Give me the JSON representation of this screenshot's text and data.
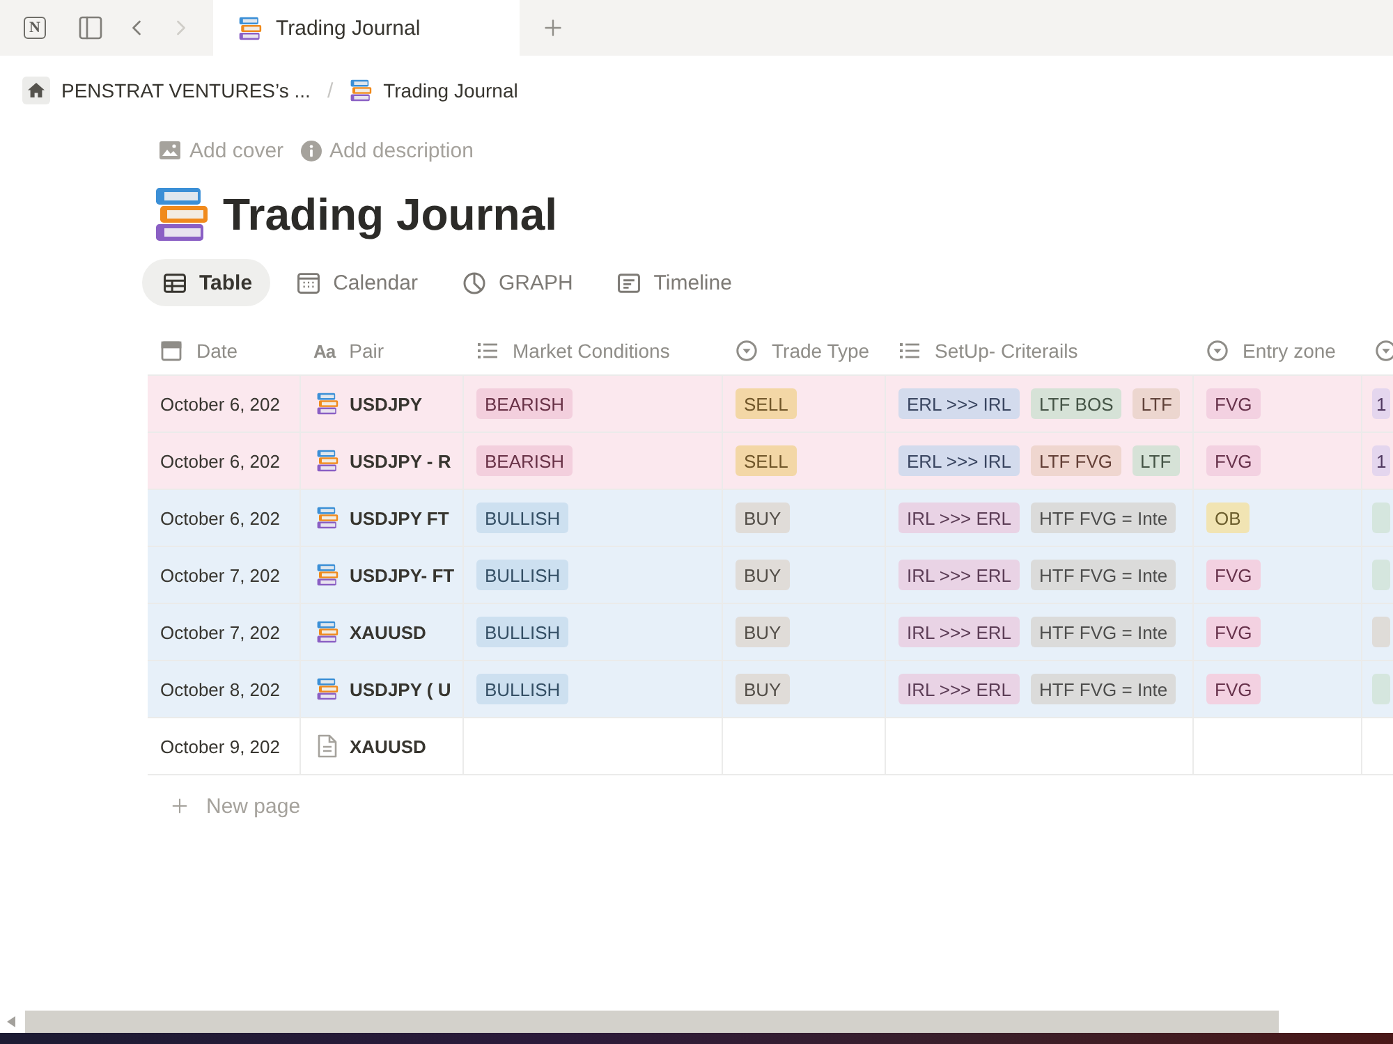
{
  "app": {
    "logo": "N"
  },
  "nav_buttons": [
    {
      "kind": "sidebar",
      "disabled": false
    },
    {
      "kind": "back",
      "disabled": false
    },
    {
      "kind": "forward",
      "disabled": true
    }
  ],
  "browser_tabs": [
    {
      "title": "Trading Journal",
      "selected": true
    }
  ],
  "breadcrumb": {
    "separator": "/",
    "items": [
      {
        "kind": "workspace",
        "label": "PENSTRAT VENTURES’s ..."
      },
      {
        "kind": "page",
        "label": "Trading Journal"
      }
    ]
  },
  "page_actions": [
    {
      "kind": "cover",
      "label": "Add cover"
    },
    {
      "kind": "description",
      "label": "Add description"
    }
  ],
  "title": "Trading Journal",
  "views": [
    {
      "kind": "table",
      "label": "Table",
      "selected": true
    },
    {
      "kind": "calendar",
      "label": "Calendar",
      "selected": false
    },
    {
      "kind": "chart",
      "label": "GRAPH",
      "selected": false
    },
    {
      "kind": "timeline",
      "label": "Timeline",
      "selected": false
    }
  ],
  "table": {
    "columns": [
      {
        "kind": "date",
        "label": "Date"
      },
      {
        "kind": "title",
        "glyph": "Aa",
        "label": "Pair"
      },
      {
        "kind": "multi",
        "label": "Market Conditions"
      },
      {
        "kind": "select",
        "label": "Trade Type"
      },
      {
        "kind": "multi",
        "label": "SetUp- Criterails"
      },
      {
        "kind": "select",
        "label": "Entry zone"
      },
      {
        "kind": "select"
      }
    ],
    "rows": [
      {
        "color": "#fbe8ee",
        "cells": [
          "October 6, 202",
          {
            "text": "USDJPY",
            "kind": "emoji"
          },
          [
            {
              "text": "BEARISH",
              "color": "#f3cfdd"
            }
          ],
          {
            "text": "SELL",
            "color": "#f3d7a6"
          },
          [
            {
              "text": "ERL >>> IRL",
              "color": "#d3dbed"
            },
            {
              "text": "LTF BOS",
              "color": "#d6e2d7"
            },
            {
              "text": "LTF",
              "color": "#ecd6cf"
            }
          ],
          {
            "text": "FVG",
            "color": "#f3d1e1"
          },
          {
            "text": "1",
            "color": "#e4d6ee"
          }
        ]
      },
      {
        "color": "#fbe8ee",
        "cells": [
          "October 6, 202",
          {
            "text": "USDJPY - R",
            "kind": "emoji"
          },
          [
            {
              "text": "BEARISH",
              "color": "#f3cfdd"
            }
          ],
          {
            "text": "SELL",
            "color": "#f3d7a6"
          },
          [
            {
              "text": "ERL >>> IRL",
              "color": "#d3dbed"
            },
            {
              "text": "LTF FVG",
              "color": "#efd6cf"
            },
            {
              "text": "LTF",
              "color": "#d6e2d7"
            }
          ],
          {
            "text": "FVG",
            "color": "#f3d1e1"
          },
          {
            "text": "1",
            "color": "#e4d6ee"
          }
        ]
      },
      {
        "color": "#e7f0f9",
        "cells": [
          "October 6, 202",
          {
            "text": "USDJPY FT",
            "kind": "emoji"
          },
          [
            {
              "text": "BULLISH",
              "color": "#cde0f0"
            }
          ],
          {
            "text": "BUY",
            "color": "#e0dcd8"
          },
          [
            {
              "text": "IRL >>> ERL",
              "color": "#e9d3e5"
            },
            {
              "text": "HTF FVG = Inte",
              "color": "#dbdbda"
            }
          ],
          {
            "text": "OB",
            "color": "#f1e4b3"
          },
          {
            "color": "#d5e6de"
          }
        ]
      },
      {
        "color": "#e7f0f9",
        "cells": [
          "October 7, 202",
          {
            "text": "USDJPY- FT",
            "kind": "emoji"
          },
          [
            {
              "text": "BULLISH",
              "color": "#cde0f0"
            }
          ],
          {
            "text": "BUY",
            "color": "#e0dcd8"
          },
          [
            {
              "text": "IRL >>> ERL",
              "color": "#e9d3e5"
            },
            {
              "text": "HTF FVG = Inte",
              "color": "#dbdbda"
            }
          ],
          {
            "text": "FVG",
            "color": "#f3d1e1"
          },
          {
            "color": "#d5e6de"
          }
        ]
      },
      {
        "color": "#e7f0f9",
        "cells": [
          "October 7, 202",
          {
            "text": "XAUUSD",
            "kind": "emoji"
          },
          [
            {
              "text": "BULLISH",
              "color": "#cde0f0"
            }
          ],
          {
            "text": "BUY",
            "color": "#e0dcd8"
          },
          [
            {
              "text": "IRL >>> ERL",
              "color": "#e9d3e5"
            },
            {
              "text": "HTF FVG = Inte",
              "color": "#dbdbda"
            }
          ],
          {
            "text": "FVG",
            "color": "#f3d1e1"
          },
          {
            "color": "#dfdcd8"
          }
        ]
      },
      {
        "color": "#e7f0f9",
        "cells": [
          "October 8, 202",
          {
            "text": "USDJPY ( U",
            "kind": "emoji"
          },
          [
            {
              "text": "BULLISH",
              "color": "#cde0f0"
            }
          ],
          {
            "text": "BUY",
            "color": "#e0dcd8"
          },
          [
            {
              "text": "IRL >>> ERL",
              "color": "#e9d3e5"
            },
            {
              "text": "HTF FVG = Inte",
              "color": "#dbdbda"
            }
          ],
          {
            "text": "FVG",
            "color": "#f3d1e1"
          },
          {
            "color": "#d5e6de"
          }
        ]
      },
      {
        "cells": [
          "October 9, 202",
          {
            "text": "XAUUSD",
            "kind": "document"
          }
        ]
      }
    ],
    "new_row": "New page"
  }
}
